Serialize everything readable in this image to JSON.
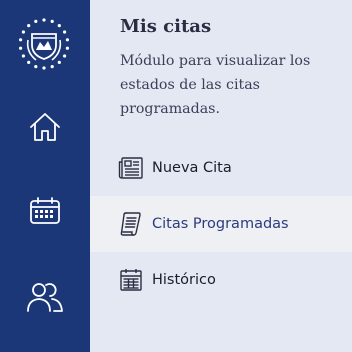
{
  "colors": {
    "rail": "#1c3778",
    "panel": "#e4e8f3",
    "active_item": "#eff0f4",
    "title": "#2a2e42",
    "active_label": "#2c3b82"
  },
  "rail": {
    "logo_icon": "national-emblem-icon",
    "items": [
      {
        "icon": "home-icon"
      },
      {
        "icon": "calendar-icon"
      },
      {
        "icon": "users-icon"
      }
    ]
  },
  "panel": {
    "title": "Mis citas",
    "description": "Módulo para visualizar los estados de las citas programadas.",
    "menu": [
      {
        "label": "Nueva Cita",
        "icon": "newspaper-icon",
        "active": false
      },
      {
        "label": "Citas Programadas",
        "icon": "scroll-document-icon",
        "active": true
      },
      {
        "label": "Histórico",
        "icon": "calendar-grid-icon",
        "active": false
      }
    ]
  }
}
